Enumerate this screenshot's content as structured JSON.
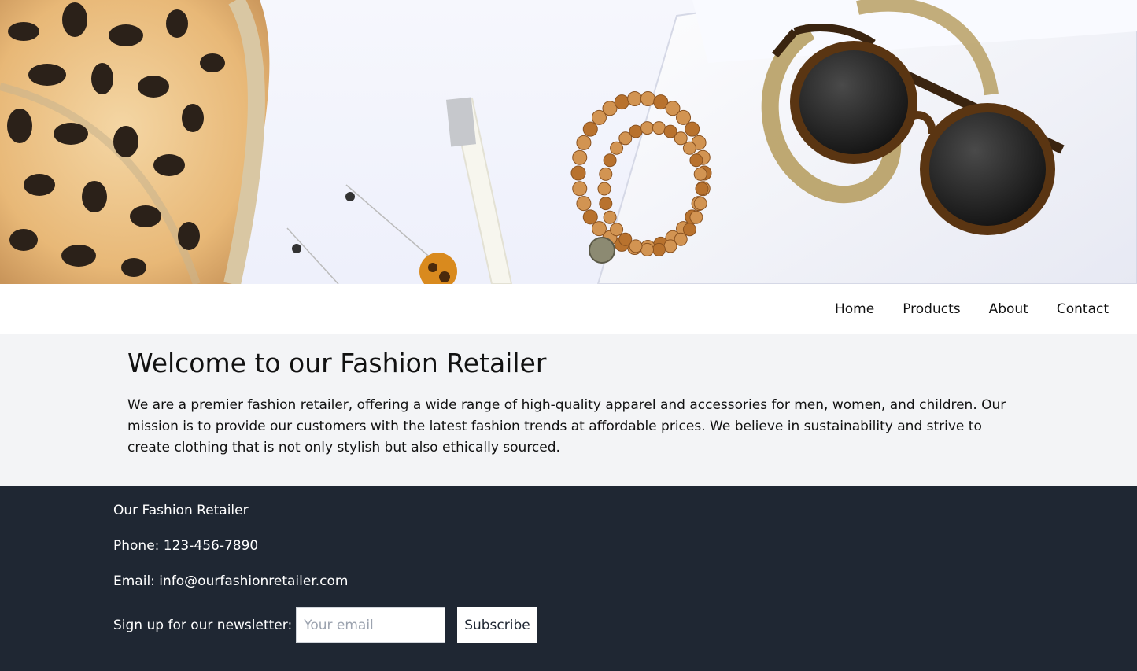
{
  "nav": {
    "items": [
      {
        "label": "Home"
      },
      {
        "label": "Products"
      },
      {
        "label": "About"
      },
      {
        "label": "Contact"
      }
    ]
  },
  "main": {
    "title": "Welcome to our Fashion Retailer",
    "intro": "We are a premier fashion retailer, offering a wide range of high-quality apparel and accessories for men, women, and children. Our mission is to provide our customers with the latest fashion trends at affordable prices. We believe in sustainability and strive to create clothing that is not only stylish but also ethically sourced."
  },
  "footer": {
    "company": "Our Fashion Retailer",
    "phone": "Phone: 123-456-7890",
    "email": "Email: info@ourfashionretailer.com",
    "newsletter_label": "Sign up for our newsletter:",
    "email_placeholder": "Your email",
    "subscribe_label": "Subscribe"
  },
  "colors": {
    "footer_bg": "#1f2733",
    "page_bg": "#f3f4f6",
    "nav_bg": "#ffffff"
  }
}
